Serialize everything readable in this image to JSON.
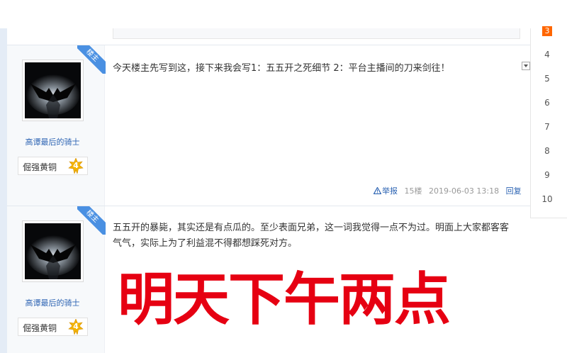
{
  "posts": [
    {
      "ribbon": "楼主",
      "username": "高谭最后的骑士",
      "badge_name": "倔强黄铜",
      "badge_level": "4",
      "content": "今天楼主先写到这，接下来我会写1：五五开之死细节 2：平台主播间的刀来剑往！",
      "report_label": "举报",
      "floor": "15楼",
      "date": "2019-06-03 13:18",
      "reply_label": "回复"
    },
    {
      "ribbon": "楼主",
      "username": "高谭最后的骑士",
      "badge_name": "倔强黄铜",
      "badge_level": "4",
      "content": "五五开的暴毙，其实还是有点瓜的。至少表面兄弟，这一词我觉得一点不为过。明面上大家都客客气气，实际上为了利益混不得都想踩死对方。",
      "overlay_text": "明天下午两点"
    }
  ],
  "page_nav": {
    "current": "3",
    "pages": [
      "4",
      "5",
      "6",
      "7",
      "8",
      "9",
      "10"
    ]
  },
  "colors": {
    "accent_blue": "#2d64b3",
    "ribbon_blue": "#4a90e2",
    "overlay_red": "#e60012",
    "page_current": "#ff6600"
  },
  "icons": [
    "report-warning-icon",
    "dropdown-arrow-icon",
    "badge-level-icon"
  ]
}
